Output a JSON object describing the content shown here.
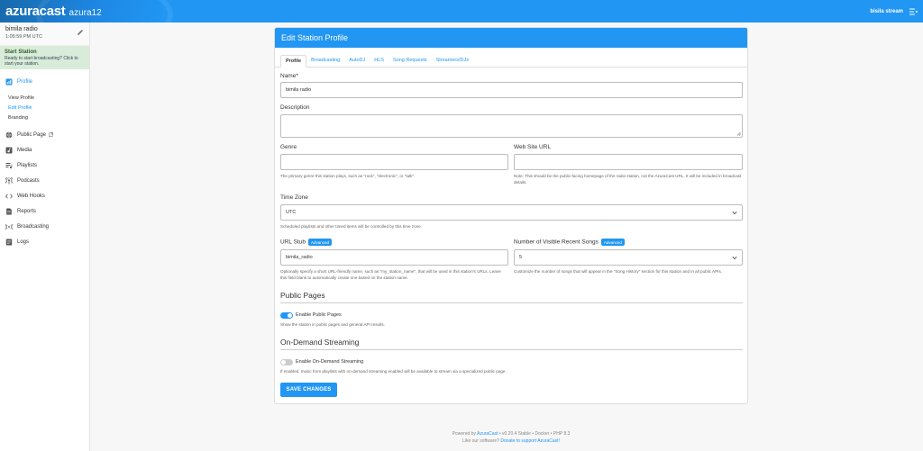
{
  "header": {
    "logo": "azuracast",
    "instance": "azura12",
    "user": "bisila stream"
  },
  "sidebar": {
    "station_name": "bimila radio",
    "time": "1:05:59 PM UTC",
    "start": {
      "title": "Start Station",
      "desc": "Ready to start broadcasting? Click to start your station."
    },
    "profile_label": "Profile",
    "sub_items": [
      "View Profile",
      "Edit Profile",
      "Branding"
    ],
    "items": [
      "Public Page",
      "Media",
      "Playlists",
      "Podcasts",
      "Web Hooks",
      "Reports",
      "Broadcasting",
      "Logs"
    ]
  },
  "card": {
    "title": "Edit Station Profile",
    "tabs": [
      "Profile",
      "Broadcasting",
      "AutoDJ",
      "HLS",
      "Song Requests",
      "Streamers/DJs"
    ],
    "name": {
      "label": "Name*",
      "value": "bimila radio"
    },
    "description": {
      "label": "Description"
    },
    "genre": {
      "label": "Genre",
      "help": "The primary genre this station plays, such as \"rock\", \"electronic\", or \"talk\"."
    },
    "website": {
      "label": "Web Site URL",
      "help": "Note: This should be the public-facing homepage of the radio station, not the AzuraCast URL. It will be included in broadcast details."
    },
    "timezone": {
      "label": "Time Zone",
      "value": "UTC",
      "help": "Scheduled playlists and other timed items will be controlled by this time zone."
    },
    "url_stub": {
      "label": "URL Stub",
      "badge": "Advanced",
      "value": "bimila_radio",
      "help": "Optionally specify a short URL-friendly name, such as \"my_station_name\", that will be used in this station's URLs. Leave this field blank to automatically create one based on the station name."
    },
    "recent_songs": {
      "label": "Number of Visible Recent Songs",
      "badge": "Advanced",
      "value": "5",
      "help": "Customize the number of songs that will appear in the \"Song History\" section for this station and in all public APIs."
    },
    "public_pages": {
      "title": "Public Pages",
      "toggle_label": "Enable Public Pages",
      "enabled": true,
      "help": "Show the station in public pages and general API results."
    },
    "on_demand": {
      "title": "On-Demand Streaming",
      "toggle_label": "Enable On-Demand Streaming",
      "enabled": false,
      "help": "If enabled, music from playlists with on-demand streaming enabled will be available to stream via a specialized public page."
    },
    "save_label": "SAVE CHANGES"
  },
  "footer": {
    "powered_prefix": "Powered by",
    "powered_link": "AzuraCast",
    "version": "• v0.20.4 Stable • Docker • PHP 8.3",
    "like_prefix": "Like our software?",
    "donate_link": "Donate to support AzuraCast!"
  },
  "colors": {
    "accent": "#2196f3",
    "start_bg": "#d9ecd9"
  }
}
